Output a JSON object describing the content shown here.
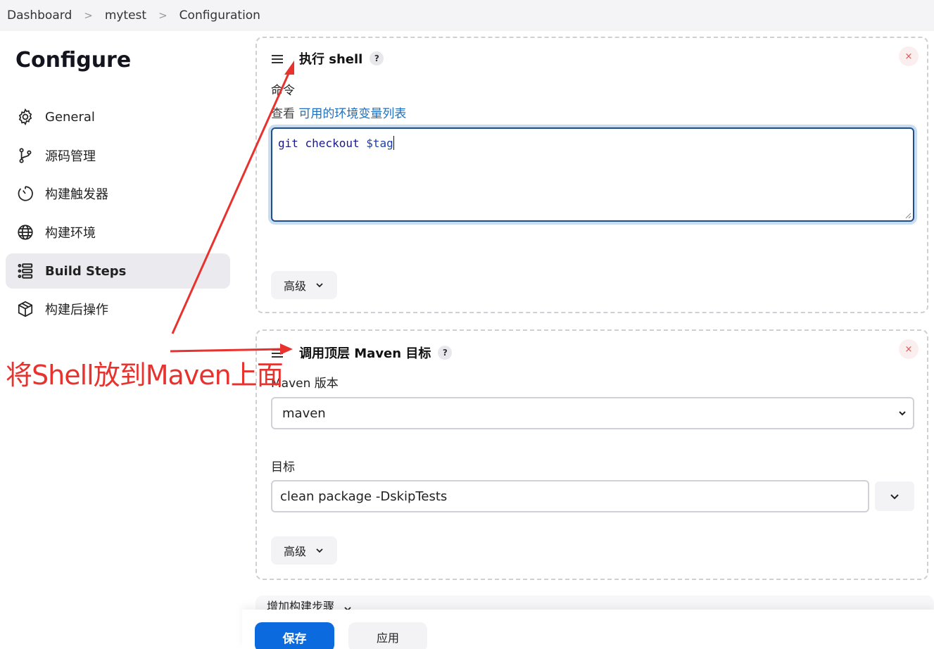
{
  "breadcrumb": {
    "items": [
      "Dashboard",
      "mytest",
      "Configuration"
    ],
    "separator": ">"
  },
  "sidebar": {
    "title": "Configure",
    "items": [
      {
        "label": "General",
        "icon": "gear-icon"
      },
      {
        "label": "源码管理",
        "icon": "branch-icon"
      },
      {
        "label": "构建触发器",
        "icon": "clock-icon"
      },
      {
        "label": "构建环境",
        "icon": "globe-icon"
      },
      {
        "label": "Build Steps",
        "icon": "list-icon",
        "active": true
      },
      {
        "label": "构建后操作",
        "icon": "package-icon"
      }
    ]
  },
  "shell_step": {
    "title": "执行 shell",
    "help": "?",
    "close": "×",
    "command_label": "命令",
    "help_prefix": "查看",
    "help_link": "可用的环境变量列表",
    "command_kw": "git checkout",
    "command_var": "$tag",
    "advanced": "高级"
  },
  "maven_step": {
    "title": "调用顶层 Maven 目标",
    "help": "?",
    "close": "×",
    "version_label": "Maven 版本",
    "version_value": "maven",
    "goals_label": "目标",
    "goals_value": "clean package -DskipTests",
    "advanced": "高级"
  },
  "add_build_step": "增加构建步骤",
  "buttons": {
    "save": "保存",
    "apply": "应用"
  },
  "annotation": {
    "text": "将Shell放到Maven上面",
    "color": "#e8322e"
  },
  "colors": {
    "primary": "#0b6bde",
    "link": "#1d6fbf",
    "focus": "#1f4e8c"
  }
}
